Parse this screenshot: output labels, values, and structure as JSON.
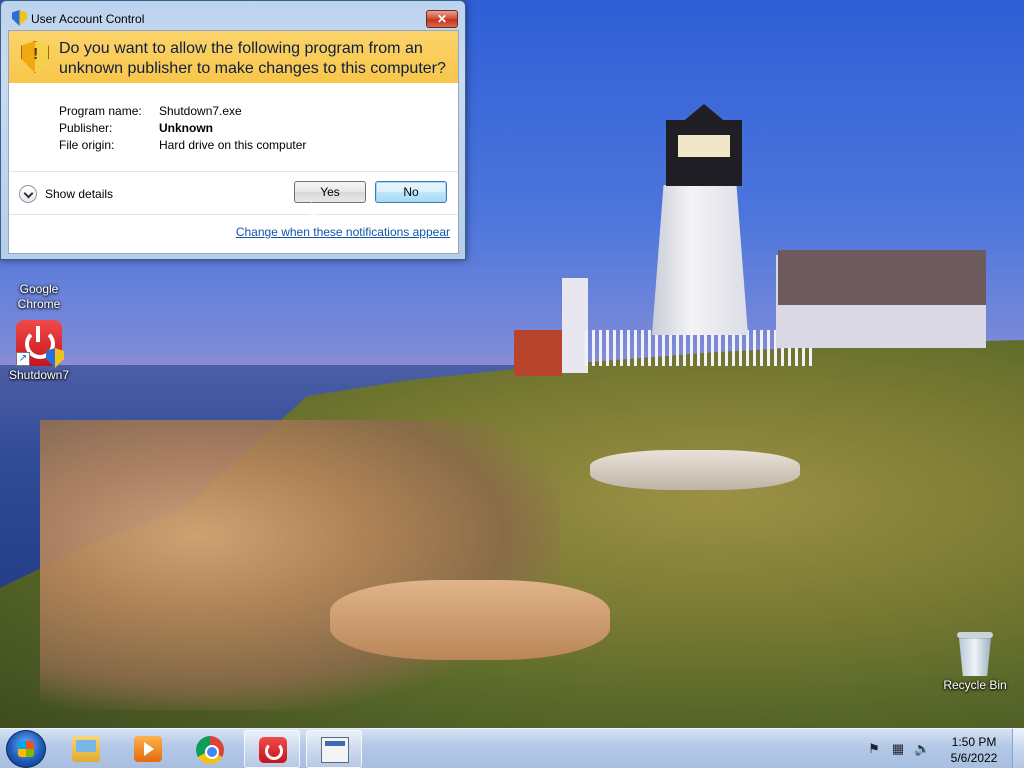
{
  "dialog": {
    "title": "User Account Control",
    "close_glyph": "✕",
    "question": "Do you want to allow the following program from an unknown publisher to make changes to this computer?",
    "fields": [
      {
        "label": "Program name:",
        "value": "Shutdown7.exe"
      },
      {
        "label": "Publisher:",
        "value": "Unknown"
      },
      {
        "label": "File origin:",
        "value": "Hard drive on this computer"
      }
    ],
    "show_details": "Show details",
    "yes_label": "Yes",
    "no_label": "No",
    "notifications_link": "Change when these notifications appear",
    "title_icon": "uac-shield-icon",
    "banner_icon": "warning-shield-icon"
  },
  "desktop": {
    "icons": [
      {
        "label": "Google Chrome",
        "icon": "chrome-icon"
      },
      {
        "label": "Shutdown7",
        "icon": "shutdown7-icon"
      },
      {
        "label": "Recycle Bin",
        "icon": "recycle-bin-icon"
      }
    ]
  },
  "taskbar": {
    "start_icon": "windows-start-icon",
    "pinned": [
      {
        "name": "windows-explorer",
        "icon": "folder-icon"
      },
      {
        "name": "windows-media-player",
        "icon": "media-player-icon"
      },
      {
        "name": "google-chrome",
        "icon": "chrome-icon"
      },
      {
        "name": "shutdown7",
        "icon": "shutdown7-icon"
      },
      {
        "name": "uac-window",
        "icon": "window-icon"
      }
    ],
    "tray_icons": [
      "action-center-flag-icon",
      "network-icon",
      "volume-icon"
    ],
    "time": "1:50 PM",
    "date": "5/6/2022"
  },
  "colors": {
    "banner": "#f8c64a",
    "link": "#1155aa",
    "taskbar": "#b3c8e6"
  }
}
